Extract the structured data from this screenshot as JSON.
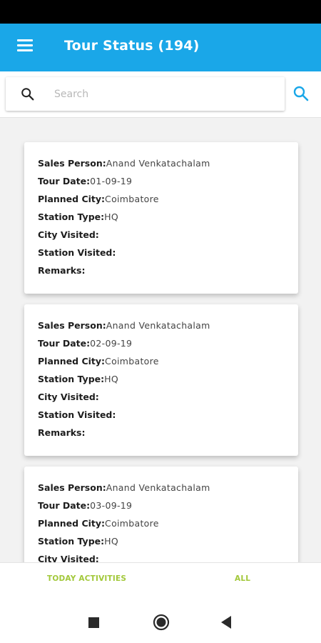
{
  "app_bar": {
    "title": "Tour Status (194)"
  },
  "search": {
    "placeholder": "Search",
    "value": ""
  },
  "labels": {
    "sales_person": "Sales Person:",
    "tour_date": "Tour Date:",
    "planned_city": "Planned City:",
    "station_type": "Station Type:",
    "city_visited": "City Visited:",
    "station_visited": "Station Visited:",
    "remarks": "Remarks:"
  },
  "cards": [
    {
      "sales_person": "Anand Venkatachalam",
      "tour_date": "01-09-19",
      "planned_city": "Coimbatore",
      "station_type": "HQ",
      "city_visited": "",
      "station_visited": "",
      "remarks": ""
    },
    {
      "sales_person": "Anand Venkatachalam",
      "tour_date": "02-09-19",
      "planned_city": "Coimbatore",
      "station_type": "HQ",
      "city_visited": "",
      "station_visited": "",
      "remarks": ""
    },
    {
      "sales_person": "Anand Venkatachalam",
      "tour_date": "03-09-19",
      "planned_city": "Coimbatore",
      "station_type": "HQ",
      "city_visited": "",
      "station_visited": "",
      "remarks": ""
    }
  ],
  "tabs": {
    "today": "TODAY ACTIVITIES",
    "all": "ALL"
  },
  "colors": {
    "app_bar": "#1aa7e8",
    "tab_text": "#a2c83a",
    "search_action": "#1aa7e8"
  },
  "icons": {
    "menu": "menu-icon",
    "search": "search-icon",
    "search_action": "search-icon",
    "nav_recents": "square-icon",
    "nav_home": "circle-icon",
    "nav_back": "triangle-back-icon"
  }
}
